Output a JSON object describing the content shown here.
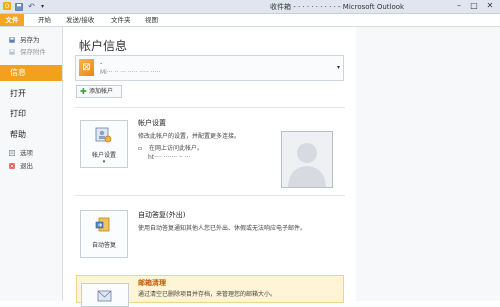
{
  "window": {
    "title": "收件箱 - · · · · · · · · · - Microsoft Outlook",
    "controls": {
      "minimize": "–",
      "maximize": "□",
      "close": "✕"
    },
    "logo_letter": "O"
  },
  "quick_access": {
    "undo": "↶",
    "dropdown": "▾"
  },
  "ribbon": {
    "tabs": [
      {
        "label": "文件"
      },
      {
        "label": "开始"
      },
      {
        "label": "发送/接收"
      },
      {
        "label": "文件夹"
      },
      {
        "label": "视图"
      }
    ]
  },
  "nav": {
    "save_as": "另存为",
    "save_attachments": "保存附件",
    "info": "信息",
    "open": "打开",
    "print": "打印",
    "help": "帮助",
    "options": "选项",
    "exit": "退出"
  },
  "main": {
    "title": "帐户信息",
    "account": {
      "name": "-",
      "type": "Mi··· ·· ··· ····· ····· ·····",
      "icon_letter": "⊠",
      "dropdown_arrow": "▾"
    },
    "add_account": "添加帐户",
    "account_settings": {
      "button_label": "帐户设置",
      "button_arrow": "▾",
      "title": "帐户设置",
      "description": "修改此帐户的设置，并配置更多连接。",
      "bullet": "▫",
      "web_access": "在网上访问此帐户。",
      "link": "ht···· ······· ·· ···"
    },
    "auto_reply": {
      "button_label": "自动答复",
      "title": "自动答复(外出)",
      "description": "使用自动答复通知其他人您已外出、休假或无法响应电子邮件。"
    },
    "cleanup": {
      "title": "邮箱清理",
      "description": "通过清空已删除项目并存档，来管理您的邮箱大小。"
    }
  },
  "colors": {
    "accent": "#f2a11d",
    "titlebar": "#dfe6ef",
    "cleanup_bg": "#fff5d6"
  }
}
